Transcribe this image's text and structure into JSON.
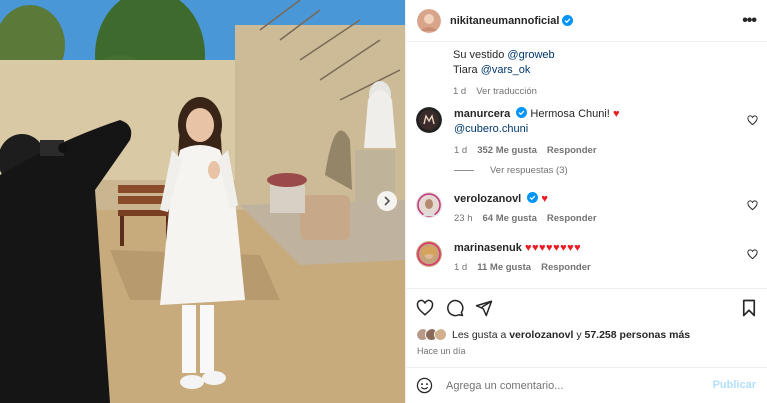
{
  "post": {
    "username": "nikitaneumannoficial",
    "caption_lines": [
      {
        "prefix": "Su vestido ",
        "mention": "@groweb"
      },
      {
        "prefix": "Tiara ",
        "mention": "@vars_ok"
      }
    ],
    "caption_time": "1 d",
    "see_translation": "Ver traducción"
  },
  "comments": [
    {
      "username": "manurcera",
      "text": "Hermosa Chuni!",
      "mention": "@cubero.chuni",
      "time": "1 d",
      "likes": "352 Me gusta",
      "reply": "Responder",
      "view_replies": "Ver respuestas (3)"
    },
    {
      "username": "verolozanovl",
      "time": "23 h",
      "likes": "64 Me gusta",
      "reply": "Responder"
    },
    {
      "username": "marinasenuk",
      "hearts": "♥♥♥♥♥♥♥♥",
      "time": "1 d",
      "likes": "11 Me gusta",
      "reply": "Responder"
    }
  ],
  "likes_summary": {
    "prefix": "Les gusta a ",
    "user": "verolozanovl",
    "middle": " y ",
    "count": "57.258 personas más"
  },
  "time_ago": "Hace un día",
  "add_comment": {
    "placeholder": "Agrega un comentario...",
    "post_label": "Publicar"
  },
  "icons": {
    "verified": "verified-badge-icon",
    "more": "more-options-icon",
    "like": "heart-icon",
    "comment": "comment-icon",
    "share": "share-icon",
    "save": "bookmark-icon",
    "emoji": "emoji-icon",
    "next": "chevron-right-icon"
  },
  "colors": {
    "verified": "#0095f6",
    "link": "#00376b",
    "heart": "#ed1c24",
    "muted": "#737373",
    "post_disabled": "#b2dffc"
  }
}
